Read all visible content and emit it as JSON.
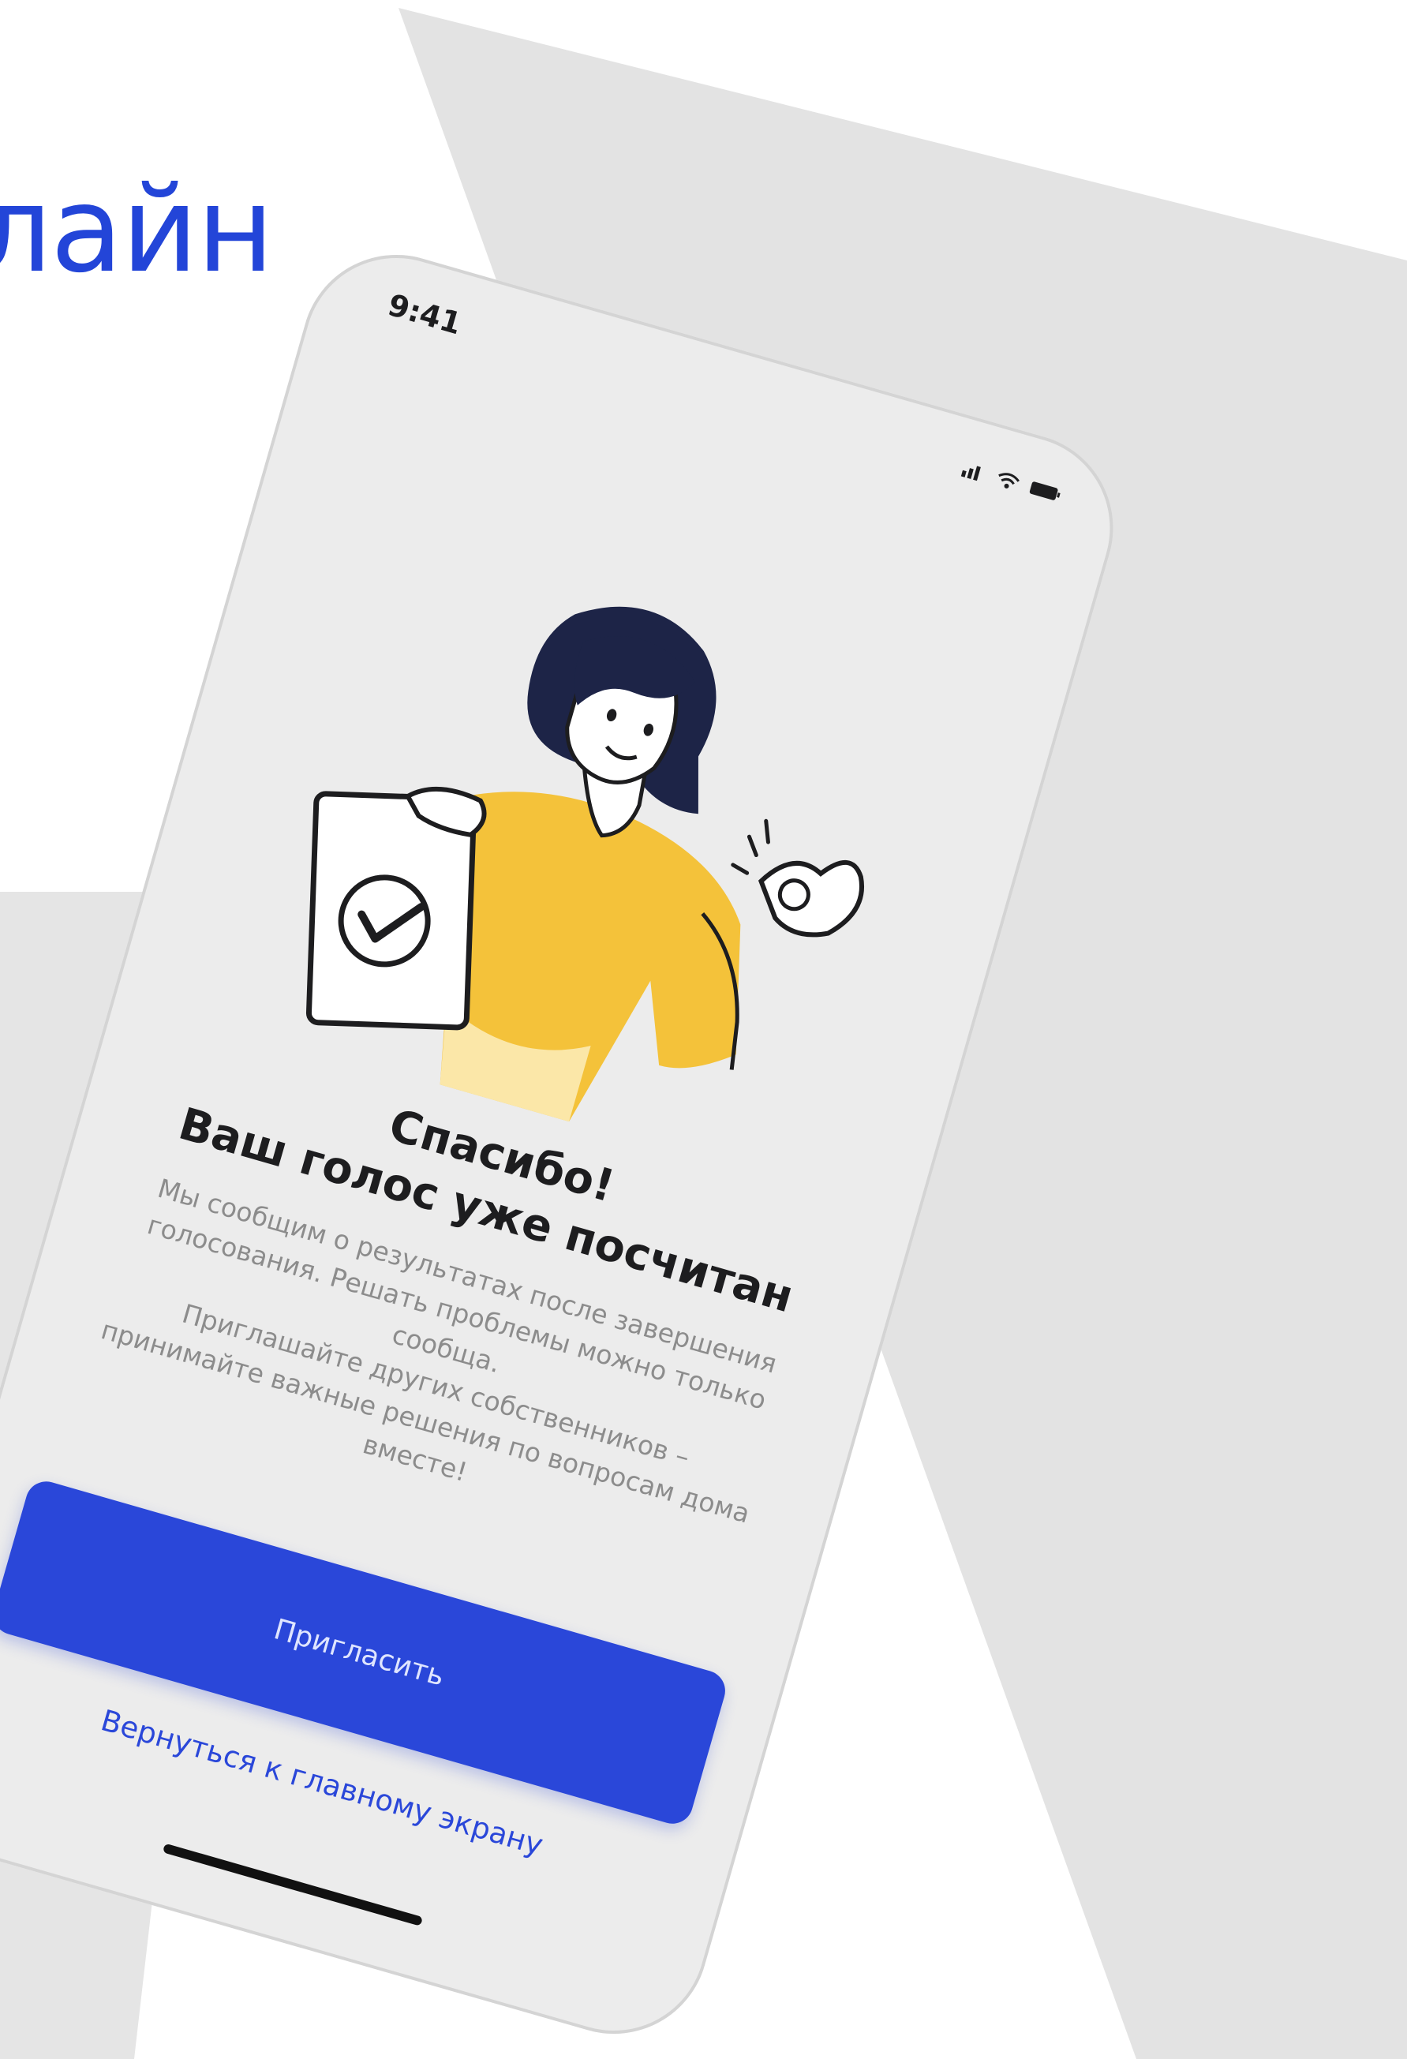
{
  "heading": "лайн",
  "colors": {
    "accent": "#2a47d9",
    "screen_bg": "#ececec",
    "text_dark": "#1d1d1f",
    "text_muted": "#8c8c8c",
    "illustration_yellow": "#f4c23a"
  },
  "status_bar": {
    "time": "9:41",
    "icons": [
      "signal-icon",
      "wifi-icon",
      "battery-icon"
    ]
  },
  "confirmation": {
    "title_line1": "Спасибо!",
    "title_line2": "Ваш голос уже посчитан",
    "paragraph1": "Мы сообщим о результатах после завершения голосования. Решать проблемы можно только сообща.",
    "paragraph2": "Приглашайте других собственников – принимайте важные решения по вопросам дома вместе!"
  },
  "actions": {
    "invite_label": "Пригласить",
    "back_label": "Вернуться к главному экрану"
  }
}
